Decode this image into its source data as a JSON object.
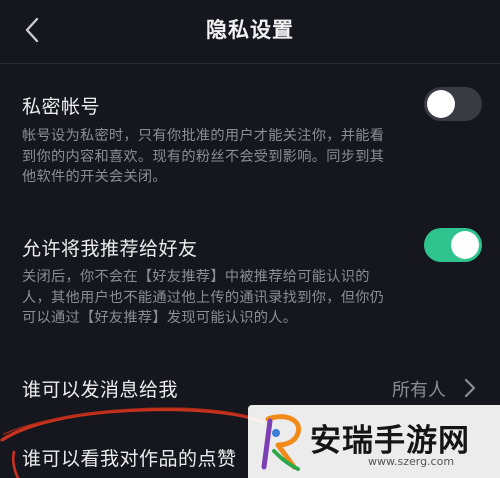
{
  "header": {
    "title": "隐私设置"
  },
  "settings": {
    "private_account": {
      "title": "私密帐号",
      "desc_lines": [
        "帐号设为私密时，只有你批准的用户才能关注你，并能看",
        "到你的内容和喜欢。现有的粉丝不会受到影响。同步到其",
        "他软件的开关会关闭。"
      ],
      "enabled": false
    },
    "recommend_to_friends": {
      "title": "允许将我推荐给好友",
      "desc_lines": [
        "关闭后，你不会在【好友推荐】中被推荐给可能认识的",
        "人，其他用户也不能通过他上传的通讯录找到你，但你仍",
        "可以通过【好友推荐】发现可能认识的人。"
      ],
      "enabled": true
    },
    "who_can_message": {
      "title": "谁可以发消息给我",
      "value": "所有人"
    },
    "who_can_see_likes": {
      "title": "谁可以看我对作品的点赞"
    }
  },
  "watermark": {
    "brand": "安瑞手游网",
    "url": "www.szerg.com"
  },
  "colors": {
    "background": "#16171e",
    "toggle_on": "#2fc48d",
    "toggle_off": "#3a3b42",
    "annotation_red": "#c8321e"
  },
  "icons": {
    "back": "chevron-left-icon",
    "row_arrow": "chevron-right-icon",
    "logo": "r-logo-icon"
  }
}
